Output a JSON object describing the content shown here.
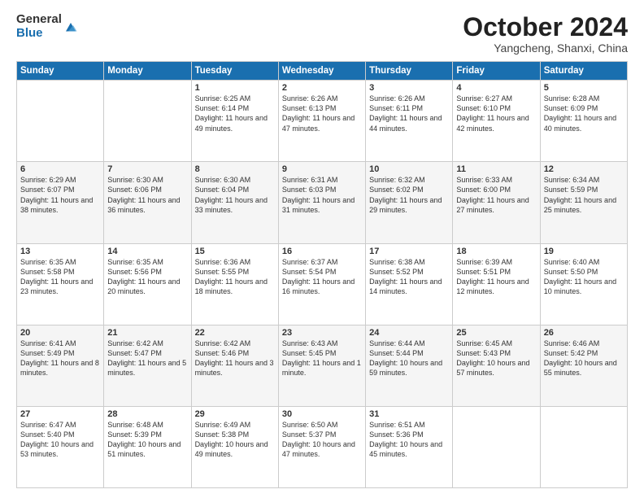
{
  "logo": {
    "general": "General",
    "blue": "Blue"
  },
  "title": "October 2024",
  "location": "Yangcheng, Shanxi, China",
  "days_of_week": [
    "Sunday",
    "Monday",
    "Tuesday",
    "Wednesday",
    "Thursday",
    "Friday",
    "Saturday"
  ],
  "weeks": [
    [
      {
        "day": "",
        "info": ""
      },
      {
        "day": "",
        "info": ""
      },
      {
        "day": "1",
        "info": "Sunrise: 6:25 AM\nSunset: 6:14 PM\nDaylight: 11 hours and 49 minutes."
      },
      {
        "day": "2",
        "info": "Sunrise: 6:26 AM\nSunset: 6:13 PM\nDaylight: 11 hours and 47 minutes."
      },
      {
        "day": "3",
        "info": "Sunrise: 6:26 AM\nSunset: 6:11 PM\nDaylight: 11 hours and 44 minutes."
      },
      {
        "day": "4",
        "info": "Sunrise: 6:27 AM\nSunset: 6:10 PM\nDaylight: 11 hours and 42 minutes."
      },
      {
        "day": "5",
        "info": "Sunrise: 6:28 AM\nSunset: 6:09 PM\nDaylight: 11 hours and 40 minutes."
      }
    ],
    [
      {
        "day": "6",
        "info": "Sunrise: 6:29 AM\nSunset: 6:07 PM\nDaylight: 11 hours and 38 minutes."
      },
      {
        "day": "7",
        "info": "Sunrise: 6:30 AM\nSunset: 6:06 PM\nDaylight: 11 hours and 36 minutes."
      },
      {
        "day": "8",
        "info": "Sunrise: 6:30 AM\nSunset: 6:04 PM\nDaylight: 11 hours and 33 minutes."
      },
      {
        "day": "9",
        "info": "Sunrise: 6:31 AM\nSunset: 6:03 PM\nDaylight: 11 hours and 31 minutes."
      },
      {
        "day": "10",
        "info": "Sunrise: 6:32 AM\nSunset: 6:02 PM\nDaylight: 11 hours and 29 minutes."
      },
      {
        "day": "11",
        "info": "Sunrise: 6:33 AM\nSunset: 6:00 PM\nDaylight: 11 hours and 27 minutes."
      },
      {
        "day": "12",
        "info": "Sunrise: 6:34 AM\nSunset: 5:59 PM\nDaylight: 11 hours and 25 minutes."
      }
    ],
    [
      {
        "day": "13",
        "info": "Sunrise: 6:35 AM\nSunset: 5:58 PM\nDaylight: 11 hours and 23 minutes."
      },
      {
        "day": "14",
        "info": "Sunrise: 6:35 AM\nSunset: 5:56 PM\nDaylight: 11 hours and 20 minutes."
      },
      {
        "day": "15",
        "info": "Sunrise: 6:36 AM\nSunset: 5:55 PM\nDaylight: 11 hours and 18 minutes."
      },
      {
        "day": "16",
        "info": "Sunrise: 6:37 AM\nSunset: 5:54 PM\nDaylight: 11 hours and 16 minutes."
      },
      {
        "day": "17",
        "info": "Sunrise: 6:38 AM\nSunset: 5:52 PM\nDaylight: 11 hours and 14 minutes."
      },
      {
        "day": "18",
        "info": "Sunrise: 6:39 AM\nSunset: 5:51 PM\nDaylight: 11 hours and 12 minutes."
      },
      {
        "day": "19",
        "info": "Sunrise: 6:40 AM\nSunset: 5:50 PM\nDaylight: 11 hours and 10 minutes."
      }
    ],
    [
      {
        "day": "20",
        "info": "Sunrise: 6:41 AM\nSunset: 5:49 PM\nDaylight: 11 hours and 8 minutes."
      },
      {
        "day": "21",
        "info": "Sunrise: 6:42 AM\nSunset: 5:47 PM\nDaylight: 11 hours and 5 minutes."
      },
      {
        "day": "22",
        "info": "Sunrise: 6:42 AM\nSunset: 5:46 PM\nDaylight: 11 hours and 3 minutes."
      },
      {
        "day": "23",
        "info": "Sunrise: 6:43 AM\nSunset: 5:45 PM\nDaylight: 11 hours and 1 minute."
      },
      {
        "day": "24",
        "info": "Sunrise: 6:44 AM\nSunset: 5:44 PM\nDaylight: 10 hours and 59 minutes."
      },
      {
        "day": "25",
        "info": "Sunrise: 6:45 AM\nSunset: 5:43 PM\nDaylight: 10 hours and 57 minutes."
      },
      {
        "day": "26",
        "info": "Sunrise: 6:46 AM\nSunset: 5:42 PM\nDaylight: 10 hours and 55 minutes."
      }
    ],
    [
      {
        "day": "27",
        "info": "Sunrise: 6:47 AM\nSunset: 5:40 PM\nDaylight: 10 hours and 53 minutes."
      },
      {
        "day": "28",
        "info": "Sunrise: 6:48 AM\nSunset: 5:39 PM\nDaylight: 10 hours and 51 minutes."
      },
      {
        "day": "29",
        "info": "Sunrise: 6:49 AM\nSunset: 5:38 PM\nDaylight: 10 hours and 49 minutes."
      },
      {
        "day": "30",
        "info": "Sunrise: 6:50 AM\nSunset: 5:37 PM\nDaylight: 10 hours and 47 minutes."
      },
      {
        "day": "31",
        "info": "Sunrise: 6:51 AM\nSunset: 5:36 PM\nDaylight: 10 hours and 45 minutes."
      },
      {
        "day": "",
        "info": ""
      },
      {
        "day": "",
        "info": ""
      }
    ]
  ]
}
